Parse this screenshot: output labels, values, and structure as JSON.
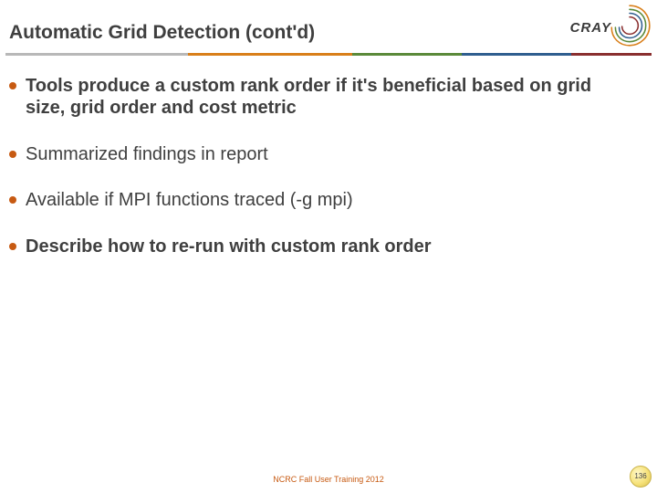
{
  "title": "Automatic Grid Detection (cont'd)",
  "logo": {
    "text": "CRAY"
  },
  "bullets": [
    {
      "text": "Tools produce a custom rank order if it's beneficial based on grid size, grid order and cost metric",
      "bold": true
    },
    {
      "text": "Summarized findings in report",
      "bold": false
    },
    {
      "text": "Available if MPI functions traced (-g mpi)",
      "bold": false
    },
    {
      "text": "Describe how to re-run with custom rank order",
      "bold": true
    }
  ],
  "footer": "NCRC Fall User Training 2012",
  "page_number": "136"
}
